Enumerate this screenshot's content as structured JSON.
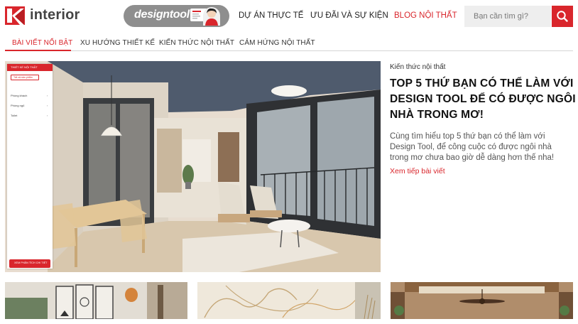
{
  "brand": {
    "logo_text": "interior",
    "design_tool_label": "designtool"
  },
  "nav": {
    "items": [
      {
        "label": "DỰ ÁN THỰC TẾ",
        "active": false
      },
      {
        "label": "ƯU ĐÃI VÀ SỰ KIỆN",
        "active": false
      },
      {
        "label": "BLOG NỘI THẤT",
        "active": true
      }
    ]
  },
  "search": {
    "placeholder": "Bạn cần tìm gì?",
    "value": ""
  },
  "tabs": [
    {
      "label": "BÀI VIẾT NỔI BẬT",
      "active": true
    },
    {
      "label": "XU HƯỚNG THIẾT KẾ",
      "active": false
    },
    {
      "label": "KIẾN THỨC NỘI THẤT",
      "active": false
    },
    {
      "label": "CẢM HỨNG NỘI THẤT",
      "active": false
    }
  ],
  "featured": {
    "category": "Kiến thức nội thất",
    "title": "TOP 5 THỨ BẠN CÓ THỂ LÀM VỚI DESIGN TOOL ĐỂ CÓ ĐƯỢC NGÔI NHÀ TRONG MƠ!",
    "description": "Cùng tìm hiểu top 5 thứ bạn có thể làm với Design Tool, để công cuộc có được ngôi nhà trong mơ chưa bao giờ dễ dàng hơn thế nha!",
    "read_more": "Xem tiếp bài viết"
  },
  "hero_panel": {
    "header": "THIẾT KẾ NỘI THẤT",
    "select": "Tất cả sản phẩm",
    "rows": [
      "Phòng khách",
      "Phòng ngủ",
      "Toilet"
    ],
    "cta": "XEM PHÂN TÍCH CHI TIẾT"
  },
  "colors": {
    "accent": "#d9262c",
    "text": "#222222",
    "muted": "#555555",
    "badge_bg": "#8e8e8e"
  },
  "icons": {
    "search": "search-icon",
    "logo": "logo-mark-icon"
  }
}
